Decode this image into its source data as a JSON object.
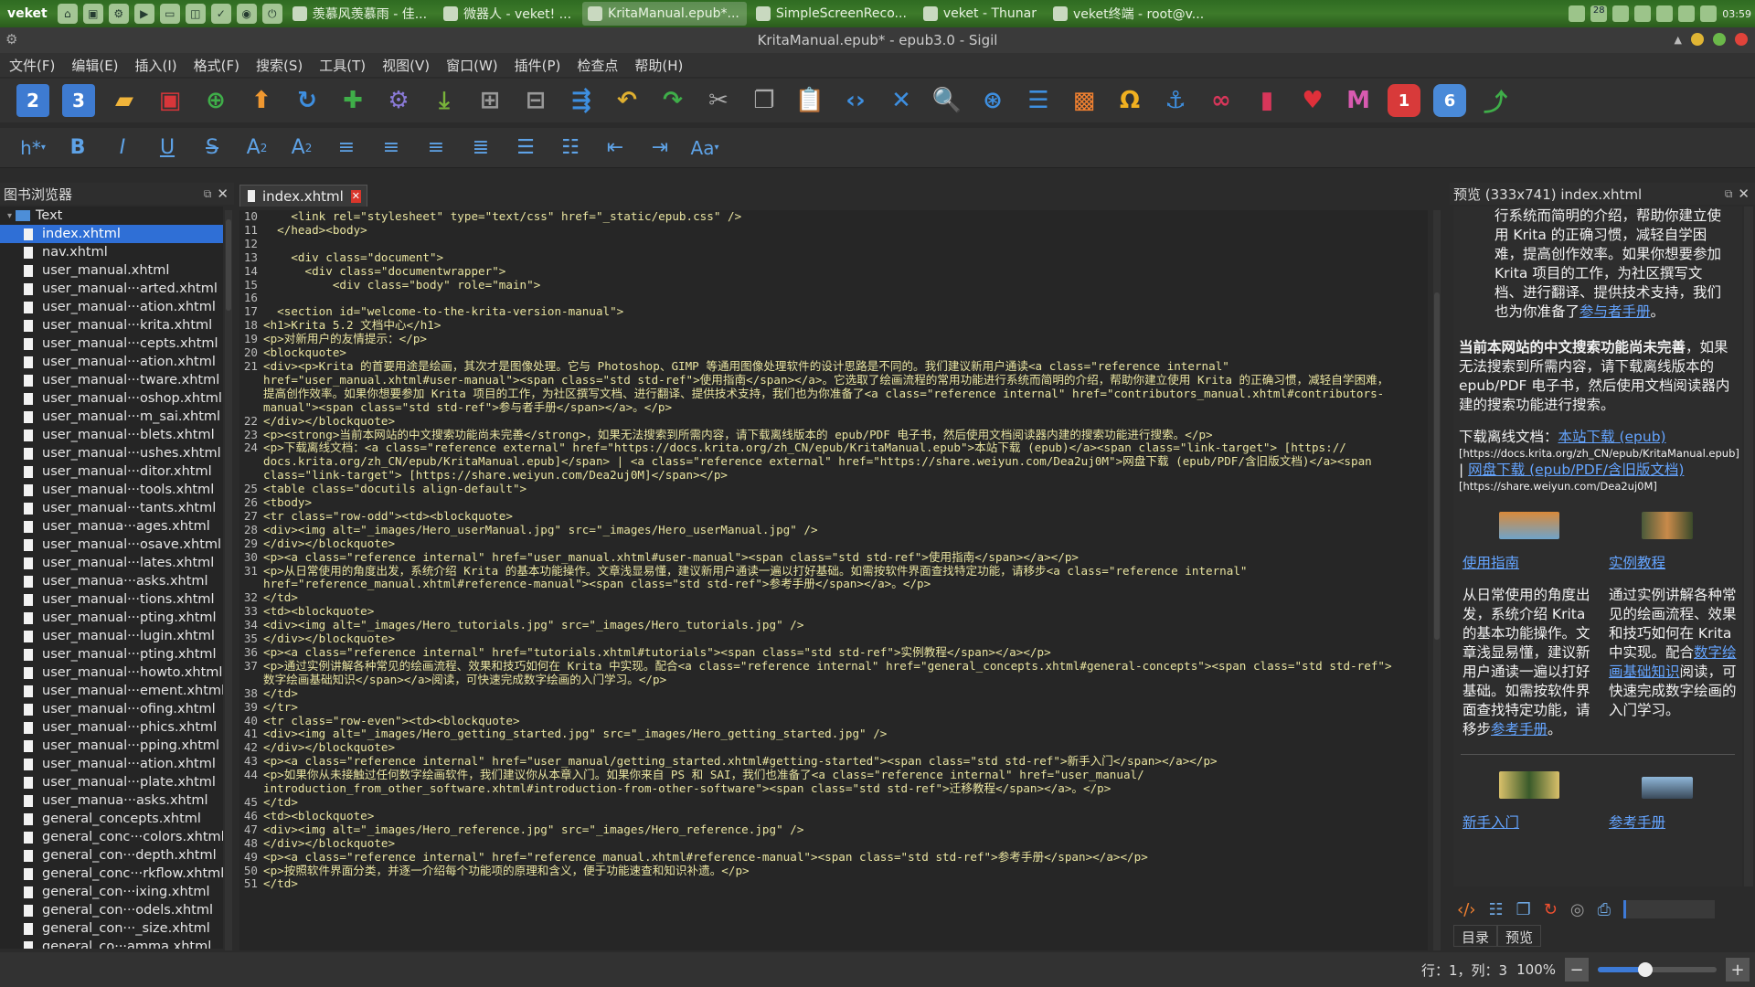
{
  "taskbar": {
    "start": "veket",
    "windows": [
      {
        "label": "羡慕风羡慕雨 - 佳...",
        "active": false
      },
      {
        "label": "微器人 - veket! ...",
        "active": false
      },
      {
        "label": "KritaManual.epub*...",
        "active": true
      },
      {
        "label": "SimpleScreenReco...",
        "active": false
      },
      {
        "label": "veket - Thunar",
        "active": false
      },
      {
        "label": "veket终端 - root@v...",
        "active": false
      }
    ],
    "tray_badge": "28",
    "clock": "03:59"
  },
  "window": {
    "title": "KritaManual.epub* - epub3.0 - Sigil"
  },
  "menu": [
    "文件(F)",
    "编辑(E)",
    "插入(I)",
    "格式(F)",
    "搜索(S)",
    "工具(T)",
    "视图(V)",
    "窗口(W)",
    "插件(P)",
    "检查点",
    "帮助(H)"
  ],
  "toolbar_icons": [
    "new-epub2-icon",
    "new-epub3-icon",
    "open-icon",
    "save-icon",
    "add-file-icon",
    "upload-icon",
    "refresh-icon",
    "add-existing-icon",
    "settings-icon",
    "meta-icon",
    "insert-row-icon",
    "remove-row-icon",
    "sort-icon",
    "undo-icon",
    "redo-icon",
    "cut-icon",
    "copy-icon",
    "paste-icon",
    "code-icon",
    "scissors-icon",
    "find-icon",
    "find-replace-icon",
    "table-icon",
    "insert-image-icon",
    "omega-icon",
    "anchor-icon",
    "link-icon",
    "bookmark-icon",
    "heart-icon",
    "mail-icon",
    "plugin-1-icon",
    "plugin-6-icon",
    "plugin-arrow-icon"
  ],
  "toolbar_badges": {
    "plugin1": "1",
    "plugin6": "6",
    "epub2": "2",
    "epub3": "3"
  },
  "format_toolbar": [
    "h*",
    "B",
    "I",
    "U",
    "S",
    "A₂",
    "A²",
    "≡",
    "≡",
    "≡",
    "≡",
    "☰",
    "☰",
    "⇤",
    "⇥",
    "Aa"
  ],
  "book_browser": {
    "title": "图书浏览器",
    "root": "Text",
    "files": [
      "index.xhtml",
      "nav.xhtml",
      "user_manual.xhtml",
      "user_manual···arted.xhtml",
      "user_manual···ation.xhtml",
      "user_manual···krita.xhtml",
      "user_manual···cepts.xhtml",
      "user_manual···ation.xhtml",
      "user_manual···tware.xhtml",
      "user_manual···oshop.xhtml",
      "user_manual···m_sai.xhtml",
      "user_manual···blets.xhtml",
      "user_manual···ushes.xhtml",
      "user_manual···ditor.xhtml",
      "user_manual···tools.xhtml",
      "user_manual···tants.xhtml",
      "user_manua···ages.xhtml",
      "user_manual···osave.xhtml",
      "user_manual···lates.xhtml",
      "user_manua···asks.xhtml",
      "user_manual···tions.xhtml",
      "user_manual···pting.xhtml",
      "user_manual···lugin.xhtml",
      "user_manual···pting.xhtml",
      "user_manual···howto.xhtml",
      "user_manual···ement.xhtml",
      "user_manual···ofing.xhtml",
      "user_manual···phics.xhtml",
      "user_manual···pping.xhtml",
      "user_manual···ation.xhtml",
      "user_manual···plate.xhtml",
      "user_manua···asks.xhtml",
      "general_concepts.xhtml",
      "general_conc···colors.xhtml",
      "general_con···depth.xhtml",
      "general_conc···rkflow.xhtml",
      "general_con···ixing.xhtml",
      "general_con···odels.xhtml",
      "general_con···_size.xhtml",
      "general_co···amma.xhtml"
    ]
  },
  "editor": {
    "tab": "index.xhtml",
    "lines": [
      {
        "n": "10",
        "t": "    <link rel=\"stylesheet\" type=\"text/css\" href=\"_static/epub.css\" />"
      },
      {
        "n": "11",
        "t": "  </head><body>"
      },
      {
        "n": "12",
        "t": ""
      },
      {
        "n": "13",
        "t": "    <div class=\"document\">"
      },
      {
        "n": "14",
        "t": "      <div class=\"documentwrapper\">"
      },
      {
        "n": "15",
        "t": "          <div class=\"body\" role=\"main\">"
      },
      {
        "n": "16",
        "t": ""
      },
      {
        "n": "17",
        "t": "  <section id=\"welcome-to-the-krita-version-manual\">"
      },
      {
        "n": "18",
        "t": "<h1>Krita 5.2 文档中心</h1>"
      },
      {
        "n": "19",
        "t": "<p>对新用户的友情提示：</p>"
      },
      {
        "n": "20",
        "t": "<blockquote>"
      },
      {
        "n": "21",
        "t": "<div><p>Krita 的首要用途是绘画，其次才是图像处理。它与 Photoshop、GIMP 等通用图像处理软件的设计思路是不同的。我们建议新用户通读<a class=\"reference internal\""
      },
      {
        "n": "",
        "t": "href=\"user_manual.xhtml#user-manual\"><span class=\"std std-ref\">使用指南</span></a>。它选取了绘画流程的常用功能进行系统而简明的介绍，帮助你建立使用 Krita 的正确习惯，减轻自学困难，"
      },
      {
        "n": "",
        "t": "提高创作效率。如果你想要参加 Krita 项目的工作，为社区撰写文档、进行翻译、提供技术支持，我们也为你准备了<a class=\"reference internal\" href=\"contributors_manual.xhtml#contributors-"
      },
      {
        "n": "",
        "t": "manual\"><span class=\"std std-ref\">参与者手册</span></a>。</p>"
      },
      {
        "n": "22",
        "t": "</div></blockquote>"
      },
      {
        "n": "23",
        "t": "<p><strong>当前本网站的中文搜索功能尚未完善</strong>，如果无法搜索到所需内容，请下载离线版本的 epub/PDF 电子书，然后使用文档阅读器内建的搜索功能进行搜索。</p>"
      },
      {
        "n": "24",
        "t": "<p>下载离线文档：<a class=\"reference external\" href=\"https://docs.krita.org/zh_CN/epub/KritaManual.epub\">本站下载 (epub)</a><span class=\"link-target\"> [https://"
      },
      {
        "n": "",
        "t": "docs.krita.org/zh_CN/epub/KritaManual.epub]</span> | <a class=\"reference external\" href=\"https://share.weiyun.com/Dea2uj0M\">网盘下载 (epub/PDF/含旧版文档)</a><span"
      },
      {
        "n": "",
        "t": "class=\"link-target\"> [https://share.weiyun.com/Dea2uj0M]</span></p>"
      },
      {
        "n": "25",
        "t": "<table class=\"docutils align-default\">"
      },
      {
        "n": "26",
        "t": "<tbody>"
      },
      {
        "n": "27",
        "t": "<tr class=\"row-odd\"><td><blockquote>"
      },
      {
        "n": "28",
        "t": "<div><img alt=\"_images/Hero_userManual.jpg\" src=\"_images/Hero_userManual.jpg\" />"
      },
      {
        "n": "29",
        "t": "</div></blockquote>"
      },
      {
        "n": "30",
        "t": "<p><a class=\"reference internal\" href=\"user_manual.xhtml#user-manual\"><span class=\"std std-ref\">使用指南</span></a></p>"
      },
      {
        "n": "31",
        "t": "<p>从日常使用的角度出发，系统介绍 Krita 的基本功能操作。文章浅显易懂，建议新用户通读一遍以打好基础。如需按软件界面查找特定功能，请移步<a class=\"reference internal\""
      },
      {
        "n": "",
        "t": "href=\"reference_manual.xhtml#reference-manual\"><span class=\"std std-ref\">参考手册</span></a>。</p>"
      },
      {
        "n": "32",
        "t": "</td>"
      },
      {
        "n": "33",
        "t": "<td><blockquote>"
      },
      {
        "n": "34",
        "t": "<div><img alt=\"_images/Hero_tutorials.jpg\" src=\"_images/Hero_tutorials.jpg\" />"
      },
      {
        "n": "35",
        "t": "</div></blockquote>"
      },
      {
        "n": "36",
        "t": "<p><a class=\"reference internal\" href=\"tutorials.xhtml#tutorials\"><span class=\"std std-ref\">实例教程</span></a></p>"
      },
      {
        "n": "37",
        "t": "<p>通过实例讲解各种常见的绘画流程、效果和技巧如何在 Krita 中实现。配合<a class=\"reference internal\" href=\"general_concepts.xhtml#general-concepts\"><span class=\"std std-ref\">"
      },
      {
        "n": "",
        "t": "数字绘画基础知识</span></a>阅读，可快速完成数字绘画的入门学习。</p>"
      },
      {
        "n": "38",
        "t": "</td>"
      },
      {
        "n": "39",
        "t": "</tr>"
      },
      {
        "n": "40",
        "t": "<tr class=\"row-even\"><td><blockquote>"
      },
      {
        "n": "41",
        "t": "<div><img alt=\"_images/Hero_getting_started.jpg\" src=\"_images/Hero_getting_started.jpg\" />"
      },
      {
        "n": "42",
        "t": "</div></blockquote>"
      },
      {
        "n": "43",
        "t": "<p><a class=\"reference internal\" href=\"user_manual/getting_started.xhtml#getting-started\"><span class=\"std std-ref\">新手入门</span></a></p>"
      },
      {
        "n": "44",
        "t": "<p>如果你从未接触过任何数字绘画软件，我们建议你从本章入门。如果你来自 PS 和 SAI，我们也准备了<a class=\"reference internal\" href=\"user_manual/"
      },
      {
        "n": "",
        "t": "introduction_from_other_software.xhtml#introduction-from-other-software\"><span class=\"std std-ref\">迁移教程</span></a>。</p>"
      },
      {
        "n": "45",
        "t": "</td>"
      },
      {
        "n": "46",
        "t": "<td><blockquote>"
      },
      {
        "n": "47",
        "t": "<div><img alt=\"_images/Hero_reference.jpg\" src=\"_images/Hero_reference.jpg\" />"
      },
      {
        "n": "48",
        "t": "</div></blockquote>"
      },
      {
        "n": "49",
        "t": "<p><a class=\"reference internal\" href=\"reference_manual.xhtml#reference-manual\"><span class=\"std std-ref\">参考手册</span></a></p>"
      },
      {
        "n": "50",
        "t": "<p>按照软件界面分类，并逐一介绍每个功能项的原理和含义，便于功能速查和知识补遗。</p>"
      },
      {
        "n": "51",
        "t": "</td>"
      }
    ]
  },
  "preview": {
    "title": "预览 (333x741) index.xhtml",
    "para1": "行系统而简明的介绍，帮助你建立使用 Krita 的正确习惯，减轻自学困难，提高创作效率。如果你想要参加 Krita 项目的工作，为社区撰写文档、进行翻译、提供技术支持，我们也为你准备了",
    "para1_link": "参与者手册",
    "para1_end": "。",
    "strong": "当前本网站的中文搜索功能尚未完善",
    "para2": "，如果无法搜索到所需内容，请下载离线版本的 epub/PDF 电子书，然后使用文档阅读器内建的搜索功能进行搜索。",
    "dl_label": "下载离线文档：",
    "dl_link1": "本站下载 (epub)",
    "dl_url1": "[https://docs.krita.org/zh_CN/epub/KritaManual.epub]",
    "dl_sep": "|",
    "dl_link2": "网盘下载 (epub/PDF/含旧版文档)",
    "dl_url2": "[https://share.weiyun.com/Dea2uj0M]",
    "card1_link": "使用指南",
    "card1_text": "从日常使用的角度出发，系统介绍 Krita 的基本功能操作。文章浅显易懂，建议新用户通读一遍以打好基础。如需按软件界面查找特定功能，请移步",
    "card1_link2": "参考手册",
    "card1_end": "。",
    "card2_link": "实例教程",
    "card2_text": "通过实例讲解各种常见的绘画流程、效果和技巧如何在 Krita 中实现。配合",
    "card2_link2": "数字绘画基础知识",
    "card2_end": "阅读，可快速完成数字绘画的入门学习。",
    "card3_link": "新手入门",
    "card4_link": "参考手册",
    "tabs": [
      "目录",
      "预览"
    ]
  },
  "status": {
    "position": "行：1，列：3",
    "zoom": "100%",
    "zoom_fraction": 0.4
  }
}
